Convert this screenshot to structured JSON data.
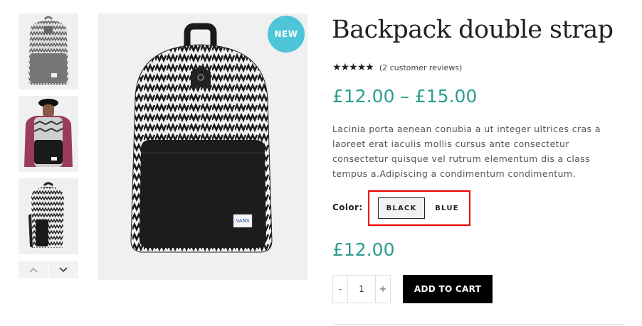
{
  "product": {
    "title": "Backpack double strap",
    "badge": "NEW",
    "rating_stars": 5,
    "reviews_text": "(2 customer reviews)",
    "price_range": "£12.00 – £15.00",
    "description": "Lacinia porta aenean conubia a ut integer ultrices cras a laoreet erat iaculis mollis cursus ante consectetur consectetur quisque vel rutrum elementum dis a class tempus a.Adipiscing a condimentum condimentum.",
    "color_label": "Color:",
    "color_options": [
      "BLACK",
      "BLUE"
    ],
    "selected_color": "BLACK",
    "selected_price": "£12.00",
    "quantity": "1",
    "qty_minus": "-",
    "qty_plus": "+",
    "add_to_cart": "ADD TO CART"
  },
  "gallery": {
    "thumbnails": [
      "backpack-front-thumb",
      "backpack-worn-thumb",
      "backpack-side-thumb"
    ],
    "main_image": "backpack-front-image"
  },
  "colors": {
    "accent": "#2a9d8f",
    "badge": "#4fc5d9",
    "highlight_box": "#ee0000",
    "button_bg": "#000000"
  }
}
